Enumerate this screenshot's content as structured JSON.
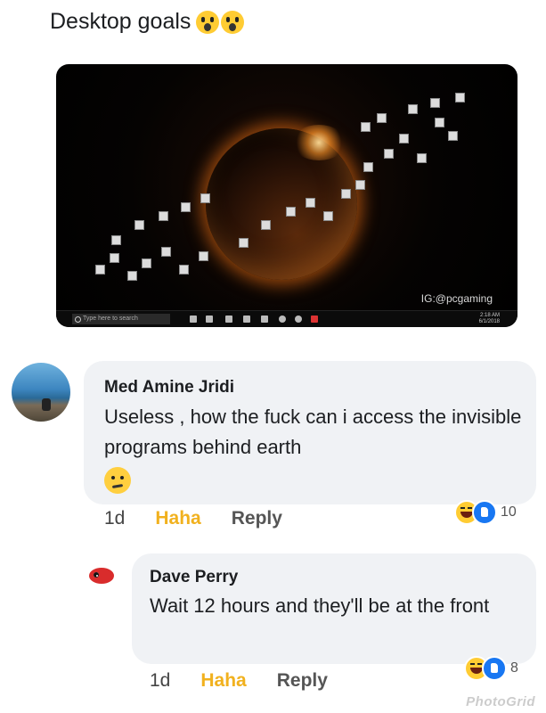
{
  "post": {
    "title": "Desktop goals"
  },
  "screenshot": {
    "watermark": "IG:@pcgaming",
    "search_placeholder": "Type here to search",
    "clock_time": "2:18 AM",
    "clock_date": "6/1/2018"
  },
  "comments": [
    {
      "author": "Med Amine Jridi",
      "text": "Useless , how the fuck can i access the invisible programs behind earth",
      "time": "1d",
      "haha_label": "Haha",
      "reply_label": "Reply",
      "reaction_count": "10"
    },
    {
      "author": "Dave  Perry",
      "text": "Wait 12 hours and they'll be at the front",
      "time": "1d",
      "haha_label": "Haha",
      "reply_label": "Reply",
      "reaction_count": "8"
    }
  ],
  "watermark": "PhotoGrid",
  "icons": {
    "title_emoji": "screaming-face-emoji",
    "comment_emoji": "confused-face-emoji",
    "reactions": [
      "haha-reaction-icon",
      "like-reaction-icon"
    ]
  },
  "colors": {
    "haha": "#f1b11e",
    "like": "#1877f2",
    "bubble": "#f0f2f5"
  }
}
